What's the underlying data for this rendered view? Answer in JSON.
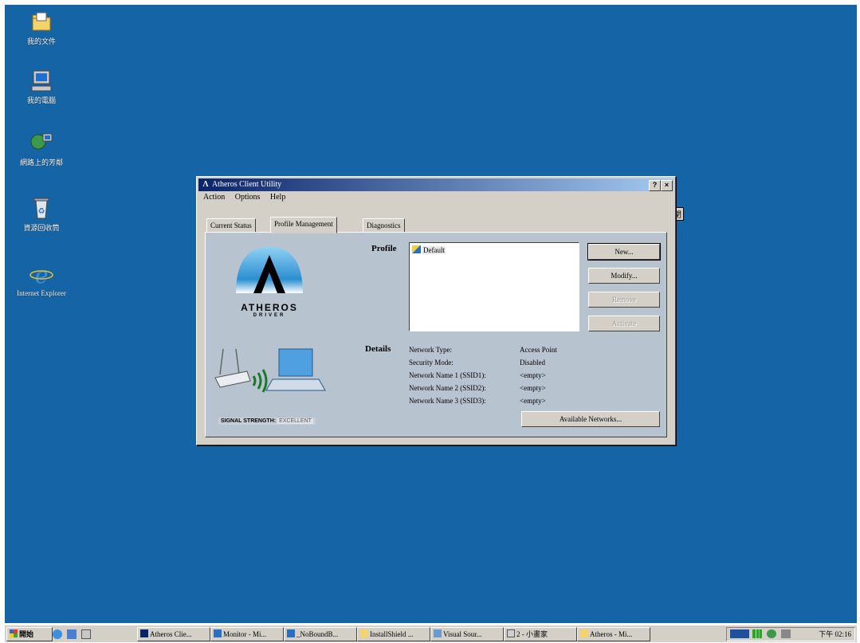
{
  "desktop_icons": [
    {
      "label": "我的文件",
      "icon": "folder-documents-icon"
    },
    {
      "label": "我的電腦",
      "icon": "computer-icon"
    },
    {
      "label": "網路上的芳鄰",
      "icon": "network-icon"
    },
    {
      "label": "資源回收筒",
      "icon": "recycle-bin-icon"
    },
    {
      "label": "Internet Explorer",
      "icon": "internet-explorer-icon"
    }
  ],
  "dialog": {
    "title": "Atheros Client Utility",
    "help_btn": "?",
    "close_btn": "×",
    "menu": [
      "Action",
      "Options",
      "Help"
    ],
    "tabs": [
      "Current Status",
      "Profile Management",
      "Diagnostics"
    ],
    "active_tab": "Profile Management",
    "logo_text": "ATHEROS",
    "logo_sub": "DRIVER",
    "signal_label": "SIGNAL STRENGTH:",
    "signal_value": "EXCELLENT",
    "profile_label": "Profile",
    "profiles": [
      "Default"
    ],
    "buttons": {
      "new": "New...",
      "modify": "Modify...",
      "remove": "Remove",
      "activate": "Activate",
      "available": "Available Networks..."
    },
    "details_label": "Details",
    "details": [
      {
        "key": "Network Type:",
        "value": "Access Point"
      },
      {
        "key": "Security Mode:",
        "value": "Disabled"
      },
      {
        "key": "Network Name 1 (SSID1):",
        "value": "<empty>"
      },
      {
        "key": "Network Name 2 (SSID2):",
        "value": "<empty>"
      },
      {
        "key": "Network Name 3 (SSID3):",
        "value": "<empty>"
      }
    ],
    "side_tooltip": "關閉"
  },
  "taskbar": {
    "start": "開始",
    "tasks": [
      "Atheros Clie...",
      "Monitor - Mi...",
      "_NoBoundB...",
      "InstallShield ...",
      "Visual Sour...",
      "2 - 小畫家",
      "Atheros - Mi..."
    ],
    "clock": "下午 02:16"
  },
  "colors": {
    "desktop": "#1565a6",
    "titlebar": "#0a246a",
    "panel": "#b7c3cf"
  }
}
